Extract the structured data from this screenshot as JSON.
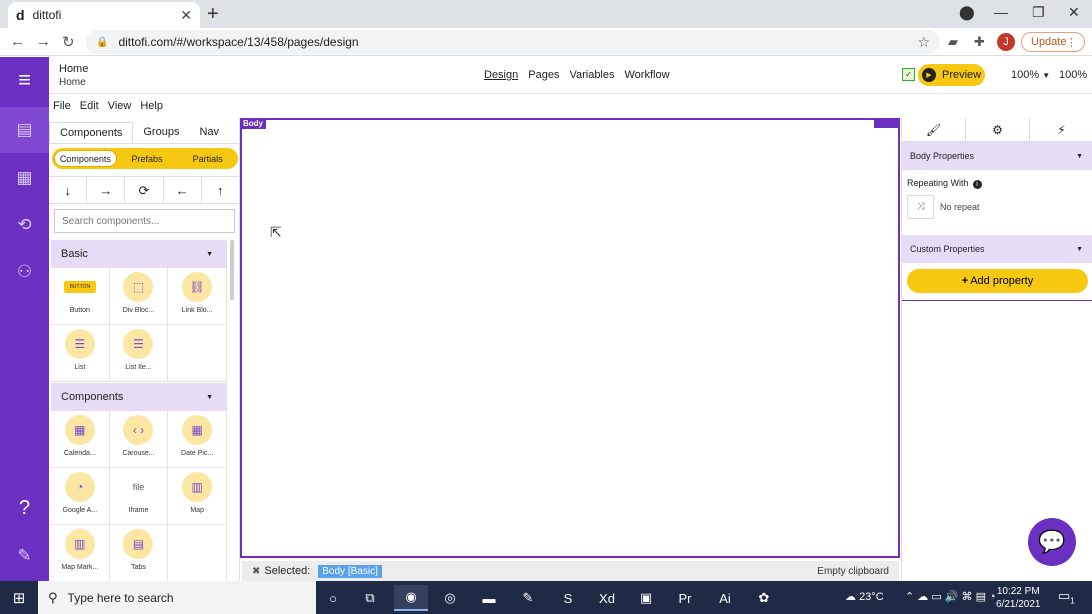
{
  "browser": {
    "tab_title": "dittofi",
    "url": "dittofi.com/#/workspace/13/458/pages/design",
    "update_label": "Update",
    "avatar_letter": "J"
  },
  "topbar": {
    "breadcrumb_title": "Home",
    "breadcrumb_sub": "Home",
    "nav": [
      "Design",
      "Pages",
      "Variables",
      "Workflow"
    ],
    "preview_label": "Preview",
    "zoom_select": "100%",
    "zoom_value": "100%"
  },
  "menu": [
    "File",
    "Edit",
    "View",
    "Help"
  ],
  "left_panel": {
    "tabs": [
      "Components",
      "Groups",
      "Nav"
    ],
    "subtabs": [
      "Components",
      "Prefabs",
      "Partials"
    ],
    "search_placeholder": "Search components...",
    "basic_header": "Basic",
    "basic_items": [
      {
        "label": "Button",
        "icon": "button-icon",
        "glyph": "BUTTON"
      },
      {
        "label": "Div Bloc...",
        "icon": "div-block-icon",
        "glyph": "⬚"
      },
      {
        "label": "Link Blo...",
        "icon": "link-block-icon",
        "glyph": "⛓"
      },
      {
        "label": "List",
        "icon": "list-icon",
        "glyph": "☰"
      },
      {
        "label": "List Ite...",
        "icon": "list-item-icon",
        "glyph": "☰"
      }
    ],
    "components_header": "Components",
    "component_items": [
      {
        "label": "Calenda...",
        "icon": "calendar-icon",
        "glyph": "▦"
      },
      {
        "label": "Carouse...",
        "icon": "carousel-icon",
        "glyph": "‹ ›"
      },
      {
        "label": "Date Pic...",
        "icon": "date-picker-icon",
        "glyph": "▦"
      },
      {
        "label": "Google A...",
        "icon": "google-analytics-icon",
        "glyph": "◔"
      },
      {
        "label": "Iframe",
        "icon": "iframe-icon",
        "glyph": "file"
      },
      {
        "label": "Map",
        "icon": "map-icon",
        "glyph": "▥"
      },
      {
        "label": "Map Mark...",
        "icon": "map-marker-icon",
        "glyph": "▥"
      },
      {
        "label": "Tabs",
        "icon": "tabs-icon",
        "glyph": "▤"
      }
    ]
  },
  "canvas": {
    "body_tag": "Body",
    "status_selected": "Selected:",
    "selected_chip": "Body [Basic]",
    "clipboard": "Empty clipboard"
  },
  "right_panel": {
    "body_properties": "Body Properties",
    "repeating_with": "Repeating With",
    "no_repeat": "No repeat",
    "custom_properties": "Custom Properties",
    "add_property": "Add property"
  },
  "taskbar": {
    "search_placeholder": "Type here to search",
    "temperature": "23°C",
    "time": "10:22 PM",
    "date": "6/21/2021",
    "notifications": "1"
  },
  "colors": {
    "brand_purple": "#6b2fc2",
    "accent_yellow": "#f6c812",
    "section_lavender": "#e6dcf6"
  }
}
